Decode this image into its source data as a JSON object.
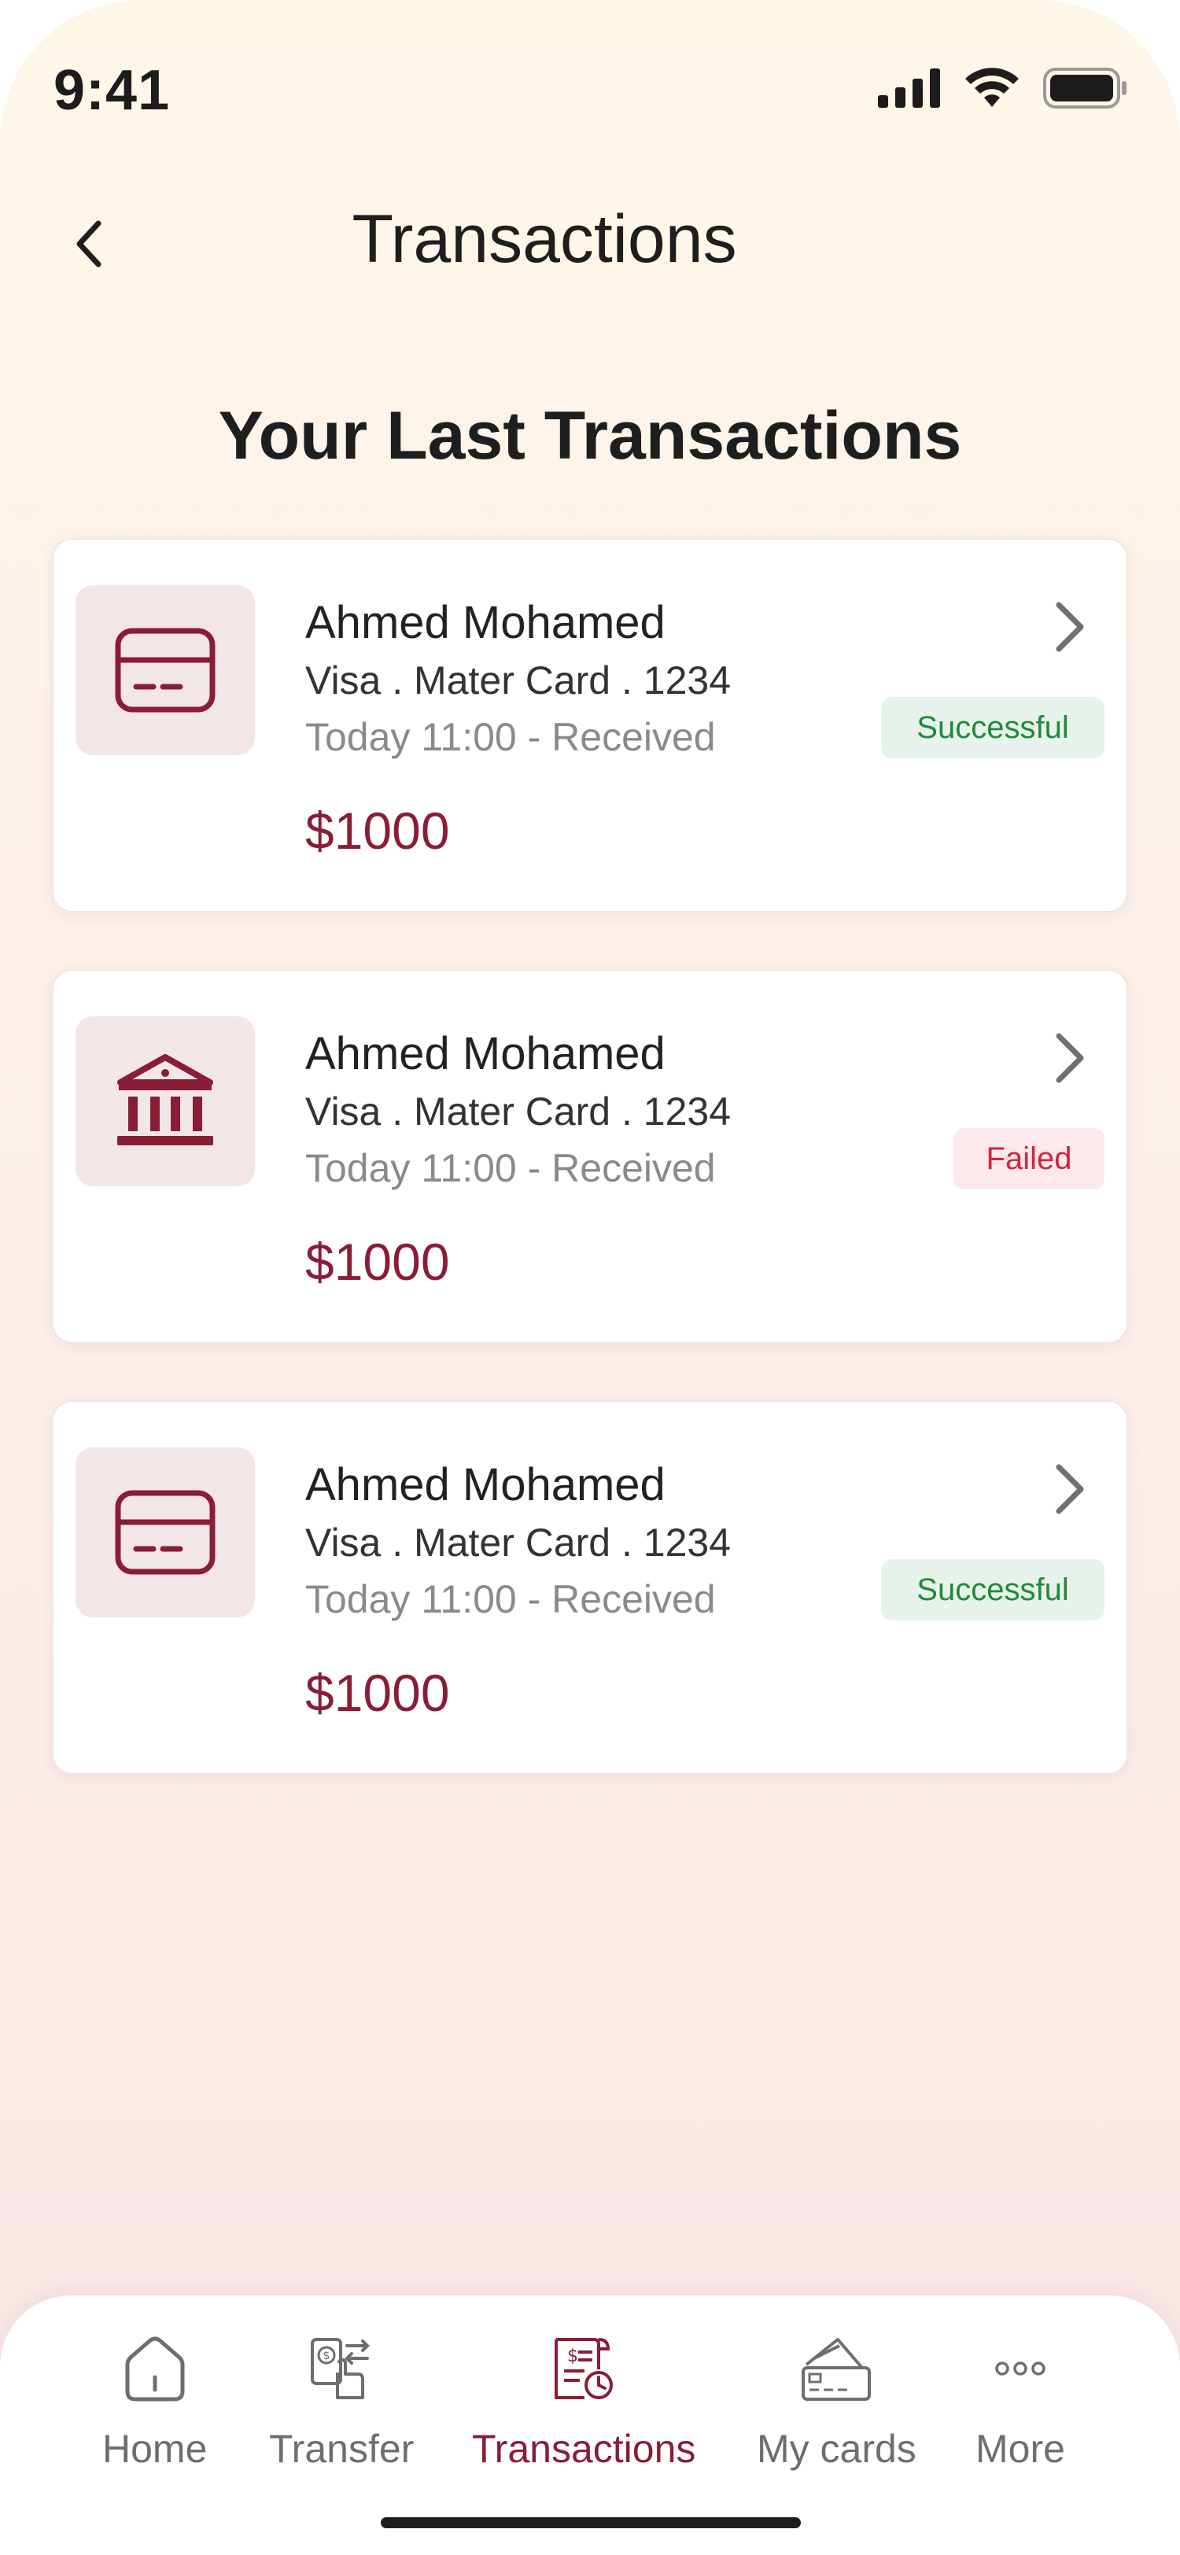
{
  "status_bar": {
    "time": "9:41"
  },
  "header": {
    "title": "Transactions"
  },
  "section_title": "Your Last Transactions",
  "colors": {
    "accent": "#8a1d36",
    "success": "#1e8a3a",
    "failed": "#d0253f"
  },
  "transactions": [
    {
      "icon": "credit-card-icon",
      "name": "Ahmed Mohamed",
      "account": "Visa . Mater Card . 1234",
      "time": "Today 11:00 - Received",
      "amount": "$1000",
      "status": "Successful"
    },
    {
      "icon": "bank-icon",
      "name": "Ahmed Mohamed",
      "account": "Visa . Mater Card . 1234",
      "time": "Today 11:00 - Received",
      "amount": "$1000",
      "status": "Failed"
    },
    {
      "icon": "credit-card-icon",
      "name": "Ahmed Mohamed",
      "account": "Visa . Mater Card . 1234",
      "time": "Today 11:00 - Received",
      "amount": "$1000",
      "status": "Successful"
    }
  ],
  "bottom_nav": {
    "active": "Transactions",
    "items": [
      {
        "label": "Home",
        "icon": "home-icon"
      },
      {
        "label": "Transfer",
        "icon": "transfer-icon"
      },
      {
        "label": "Transactions",
        "icon": "transactions-icon"
      },
      {
        "label": "My cards",
        "icon": "cards-icon"
      },
      {
        "label": "More",
        "icon": "more-icon"
      }
    ]
  }
}
